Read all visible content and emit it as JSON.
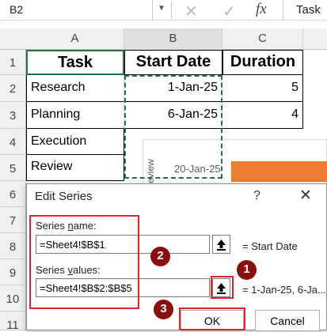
{
  "formula_bar": {
    "name_box": "B2",
    "cancel_glyph": "✕",
    "enter_glyph": "✓",
    "fx_label": "fx",
    "content": "Task"
  },
  "columns": [
    "A",
    "B",
    "C"
  ],
  "rows": [
    "1",
    "2",
    "3",
    "4",
    "5",
    "6",
    "7",
    "8",
    "9",
    "10",
    "11"
  ],
  "table": {
    "headers": [
      "Task",
      "Start Date",
      "Duration"
    ],
    "rows": [
      {
        "task": "Research",
        "start": "1-Jan-25",
        "duration": "5"
      },
      {
        "task": "Planning",
        "start": "6-Jan-25",
        "duration": "4"
      },
      {
        "task": "Execution"
      },
      {
        "task": "Review"
      }
    ]
  },
  "chart": {
    "axis_label": "20-Jan-25",
    "category_label": "eview",
    "bar_color": "#ED7D31"
  },
  "dialog": {
    "title": "Edit Series",
    "help": "?",
    "close": "✕",
    "series_name_label": "Series name:",
    "series_name_value": "=Sheet4!$B$1",
    "series_name_result": "= Start Date",
    "series_values_label": "Series values:",
    "series_values_value": "=Sheet4!$B$2:$B$5",
    "series_values_result": "= 1-Jan-25, 6-Ja...",
    "ok_label": "OK",
    "cancel_label": "Cancel"
  },
  "annotations": {
    "badge_1": "1",
    "badge_2": "2",
    "badge_3": "3",
    "highlight_color": "#E0242B",
    "badge_color": "#8B0D0D"
  },
  "colors": {
    "header_fill": "#F0F0F0",
    "marching_ants": "#217346"
  }
}
